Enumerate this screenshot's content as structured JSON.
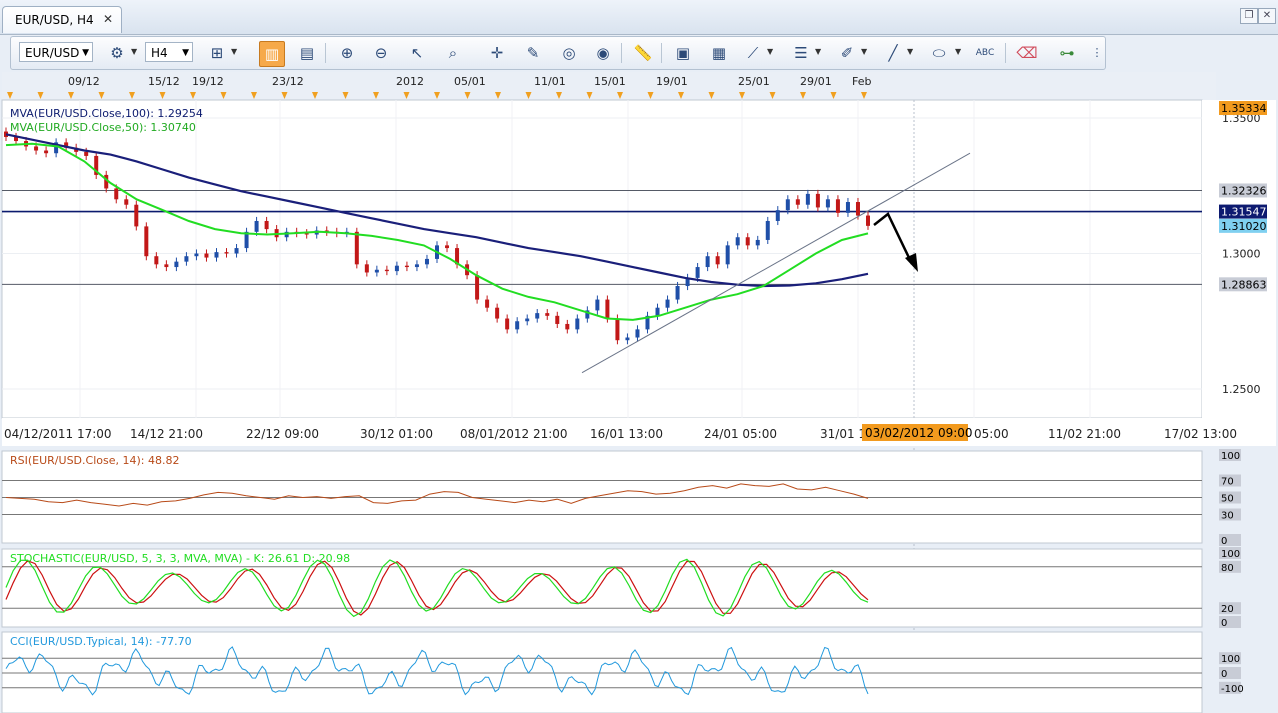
{
  "tab": {
    "title": "EUR/USD, H4",
    "close": "✕"
  },
  "window_controls": [
    "restore-icon",
    "close-icon"
  ],
  "toolbar": {
    "symbol": "EUR/USD",
    "timeframe": "H4",
    "icons": [
      "chart-type-icon",
      "indicators-icon",
      "candle-view-icon",
      "bar-view-icon",
      "zoom-in-icon",
      "zoom-out-icon",
      "cursor-icon",
      "zoom-box-icon",
      "crosshair-icon",
      "edit-chart-icon",
      "magnet-icon",
      "globe-icon",
      "ruler-icon",
      "picture-icon",
      "template-icon",
      "trendline-tool-icon",
      "horizontal-lines-icon",
      "pen-tool-icon",
      "line-tool-icon",
      "ellipse-tool-icon",
      "text-tool-icon",
      "eraser-icon",
      "object-tree-icon",
      "more-icon"
    ]
  },
  "chart_data": [
    {
      "type": "candlestick",
      "symbol": "EUR/USD",
      "timeframe": "H4",
      "ylim": [
        1.24,
        1.356
      ],
      "y_ticks": [
        "1.3500",
        "1.3000",
        "1.2500"
      ],
      "x_labels": [
        "04/12/2011 17:00",
        "14/12 21:00",
        "22/12 09:00",
        "30/12 01:00",
        "08/01/2012 21:00",
        "16/01 13:00",
        "24/01 05:00",
        "31/01 1",
        "05:00",
        "11/02 21:00",
        "17/02 13:00"
      ],
      "top_date_labels": [
        "09/12",
        "15/12",
        "19/12",
        "23/12",
        "2012",
        "05/01",
        "11/01",
        "15/01",
        "19/01",
        "25/01",
        "29/01",
        "Feb"
      ],
      "cursor_time_label": "03/02/2012 09:00",
      "price_labels": {
        "current_high": "1.35334",
        "level1": "1.32326",
        "level2": "1.31547",
        "last": "1.31020",
        "level3": "1.28863"
      },
      "overlays": [
        {
          "name": "MVA(EUR/USD.Close,100): 1.29254",
          "color": "#1a1f7a"
        },
        {
          "name": "MVA(EUR/USD.Close,50): 1.30740",
          "color": "#22dd22"
        }
      ],
      "close_series": [
        1.343,
        1.3415,
        1.3395,
        1.338,
        1.337,
        1.341,
        1.339,
        1.3375,
        1.336,
        1.329,
        1.324,
        1.32,
        1.318,
        1.31,
        1.299,
        1.296,
        1.295,
        1.297,
        1.299,
        1.3,
        1.2985,
        1.3005,
        1.3,
        1.302,
        1.308,
        1.312,
        1.309,
        1.306,
        1.308,
        1.3075,
        1.307,
        1.3085,
        1.308,
        1.3075,
        1.308,
        1.296,
        1.293,
        1.294,
        1.2935,
        1.2955,
        1.295,
        1.296,
        1.298,
        1.303,
        1.302,
        1.296,
        1.292,
        1.283,
        1.28,
        1.276,
        1.272,
        1.275,
        1.276,
        1.278,
        1.277,
        1.274,
        1.272,
        1.276,
        1.279,
        1.283,
        1.276,
        1.268,
        1.269,
        1.272,
        1.277,
        1.28,
        1.283,
        1.288,
        1.291,
        1.295,
        1.299,
        1.296,
        1.303,
        1.306,
        1.303,
        1.305,
        1.312,
        1.316,
        1.32,
        1.318,
        1.322,
        1.317,
        1.32,
        1.315,
        1.319,
        1.314,
        1.3102
      ],
      "mva100_series": [
        1.344,
        1.342,
        1.34,
        1.338,
        1.3365,
        1.334,
        1.331,
        1.328,
        1.3255,
        1.323,
        1.321,
        1.319,
        1.317,
        1.315,
        1.313,
        1.311,
        1.309,
        1.3075,
        1.306,
        1.304,
        1.302,
        1.3005,
        1.299,
        1.297,
        1.295,
        1.293,
        1.291,
        1.2895,
        1.2885,
        1.288,
        1.2882,
        1.289,
        1.2905,
        1.2925
      ],
      "mva50_series": [
        1.34,
        1.3405,
        1.3395,
        1.334,
        1.326,
        1.32,
        1.316,
        1.312,
        1.309,
        1.3075,
        1.307,
        1.3075,
        1.308,
        1.3075,
        1.3065,
        1.305,
        1.303,
        1.298,
        1.292,
        1.287,
        1.284,
        1.282,
        1.279,
        1.276,
        1.2755,
        1.277,
        1.28,
        1.283,
        1.285,
        1.288,
        1.294,
        1.3,
        1.305,
        1.3074
      ],
      "horizontal_levels": [
        1.32326,
        1.31547,
        1.28863
      ],
      "trendline": {
        "from": [
          1.256
        ],
        "to": [
          1.337
        ]
      },
      "projection_arrow": "down"
    },
    {
      "type": "line",
      "title": "RSI(EUR/USD.Close, 14): 48.82",
      "color": "#b84a18",
      "ylim": [
        0,
        100
      ],
      "y_ticks": [
        "100",
        "70",
        "50",
        "30",
        "0"
      ],
      "values": [
        50,
        49,
        48,
        45,
        44,
        47,
        44,
        42,
        40,
        43,
        41,
        45,
        46,
        49,
        53,
        56,
        55,
        52,
        50,
        48,
        52,
        50,
        51,
        49,
        51,
        52,
        44,
        43,
        46,
        47,
        54,
        57,
        56,
        50,
        48,
        46,
        44,
        47,
        45,
        48,
        43,
        49,
        52,
        55,
        58,
        57,
        54,
        55,
        58,
        62,
        64,
        61,
        66,
        64,
        63,
        66,
        60,
        59,
        62,
        58,
        54,
        49
      ]
    },
    {
      "type": "line",
      "title": "STOCHASTIC(EUR/USD, 5, 3, 3, MVA, MVA) -  K: 26.61  D: 20.98",
      "colors": [
        "#22dd22",
        "#cc1111"
      ],
      "ylim": [
        0,
        100
      ],
      "y_ticks": [
        "100",
        "80",
        "20",
        "0"
      ],
      "k_label": "K: 26.61",
      "d_label": "D: 20.98"
    },
    {
      "type": "line",
      "title": "CCI(EUR/USD.Typical, 14): -77.70",
      "color": "#2299dd",
      "ylim": [
        -250,
        250
      ],
      "y_ticks": [
        "100",
        "0",
        "-100"
      ]
    }
  ]
}
